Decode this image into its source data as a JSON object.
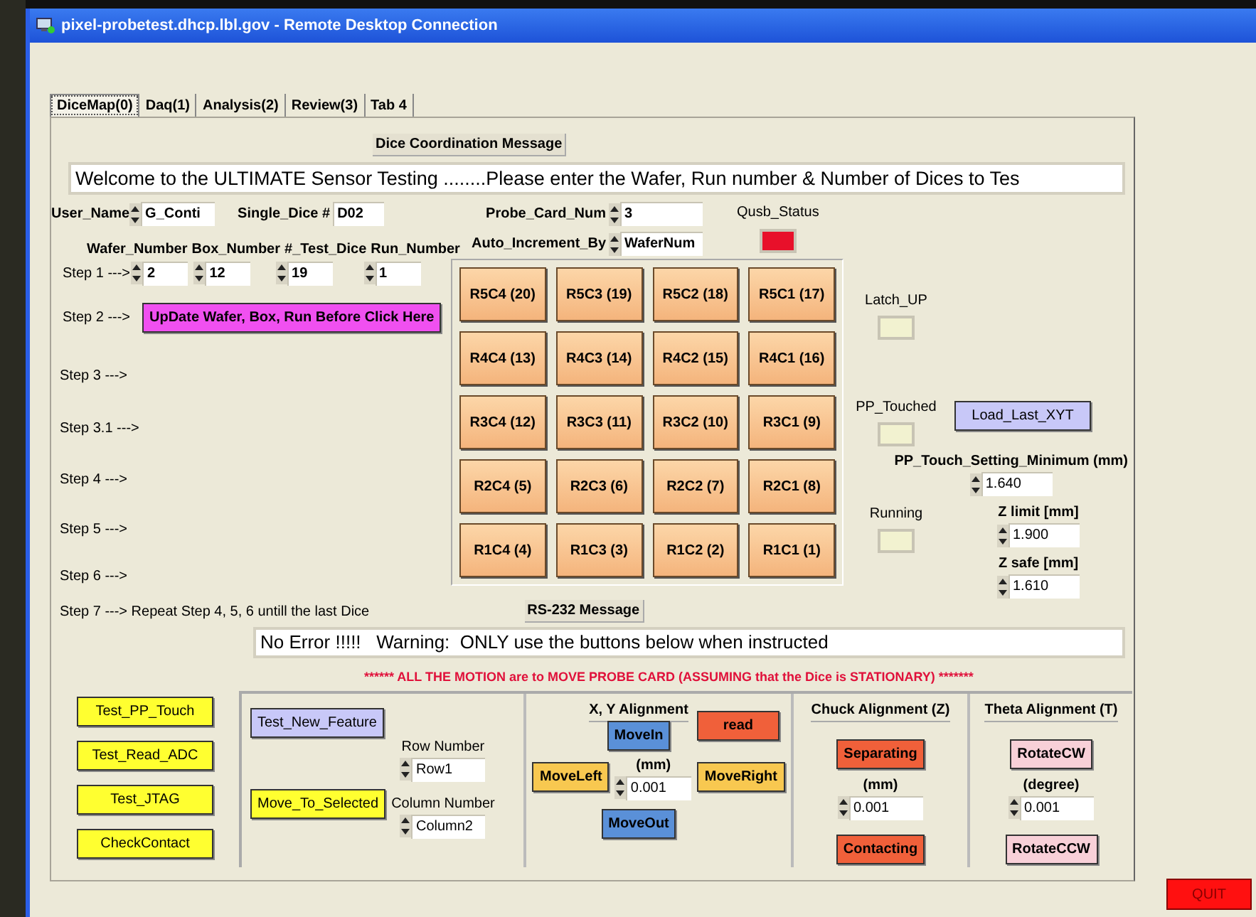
{
  "window": {
    "title": "pixel-probetest.dhcp.lbl.gov - Remote Desktop Connection"
  },
  "tabs": [
    {
      "label": "DiceMap(0)",
      "selected": true
    },
    {
      "label": "Daq(1)",
      "selected": false
    },
    {
      "label": "Analysis(2)",
      "selected": false
    },
    {
      "label": "Review(3)",
      "selected": false
    },
    {
      "label": "Tab 4",
      "selected": false
    }
  ],
  "dice_message": {
    "label": "Dice Coordination Message",
    "text": "Welcome to the ULTIMATE Sensor Testing ........Please enter the Wafer, Run number & Number of Dices to Tes"
  },
  "user_name": {
    "label": "User_Name",
    "value": "G_Conti"
  },
  "single_dice": {
    "label": "Single_Dice #",
    "value": "D02"
  },
  "probe_card": {
    "label": "Probe_Card_Num",
    "value": "3"
  },
  "auto_increment": {
    "label": "Auto_Increment_By",
    "value": "WaferNum"
  },
  "qusb_status": {
    "label": "Qusb_Status",
    "on": true
  },
  "step1_fields": [
    {
      "label": "Wafer_Number",
      "value": "2"
    },
    {
      "label": "Box_Number",
      "value": "12"
    },
    {
      "label": "#_Test_Dice",
      "value": "19"
    },
    {
      "label": "Run_Number",
      "value": "1"
    }
  ],
  "steps": [
    "Step 1 --->",
    "Step 2 --->",
    "Step 3 --->",
    "Step 3.1 --->",
    "Step 4 --->",
    "Step 5 --->",
    "Step 6 --->",
    "Step 7 ---> Repeat Step 4, 5, 6 untill the last Dice"
  ],
  "update_button": "UpDate Wafer, Box, Run Before Click Here",
  "dice_grid": [
    [
      "R5C4 (20)",
      "R5C3 (19)",
      "R5C2 (18)",
      "R5C1 (17)"
    ],
    [
      "R4C4 (13)",
      "R4C3 (14)",
      "R4C2 (15)",
      "R4C1 (16)"
    ],
    [
      "R3C4 (12)",
      "R3C3 (11)",
      "R3C2 (10)",
      "R3C1 (9)"
    ],
    [
      "R2C4 (5)",
      "R2C3 (6)",
      "R2C2 (7)",
      "R2C1 (8)"
    ],
    [
      "R1C4 (4)",
      "R1C3 (3)",
      "R1C2 (2)",
      "R1C1 (1)"
    ]
  ],
  "indicators": [
    {
      "label": "Latch_UP",
      "on": false
    },
    {
      "label": "PP_Touched",
      "on": false
    },
    {
      "label": "Running",
      "on": false
    }
  ],
  "load_last_xyt": "Load_Last_XYT",
  "settings": [
    {
      "label": "PP_Touch_Setting_Minimum (mm)",
      "value": "1.640"
    },
    {
      "label": "Z limit [mm]",
      "value": "1.900"
    },
    {
      "label": "Z safe [mm]",
      "value": "1.610"
    }
  ],
  "rs232": {
    "label": "RS-232 Message",
    "text": "No Error !!!!!   Warning:  ONLY use the buttons below when instructed"
  },
  "motion_warning": "****** ALL THE MOTION are to MOVE PROBE CARD (ASSUMING that the Dice is STATIONARY) *******",
  "test_buttons": [
    "Test_PP_Touch",
    "Test_Read_ADC",
    "Test_JTAG",
    "CheckContact"
  ],
  "feature": {
    "test_button": "Test_New_Feature",
    "move_button": "Move_To_Selected",
    "row": {
      "label": "Row Number",
      "value": "Row1"
    },
    "column": {
      "label": "Column Number",
      "value": "Column2"
    }
  },
  "xy": {
    "title": "X, Y Alignment",
    "read": "read",
    "move_in": "MoveIn",
    "move_left": "MoveLeft",
    "unit": "(mm)",
    "value": "0.001",
    "move_right": "MoveRight",
    "move_out": "MoveOut"
  },
  "chuck": {
    "title": "Chuck Alignment (Z)",
    "up": "Separating",
    "unit": "(mm)",
    "value": "0.001",
    "down": "Contacting"
  },
  "theta": {
    "title": "Theta Alignment (T)",
    "cw": "RotateCW",
    "unit": "(degree)",
    "value": "0.001",
    "ccw": "RotateCCW"
  },
  "quit": "QUIT"
}
